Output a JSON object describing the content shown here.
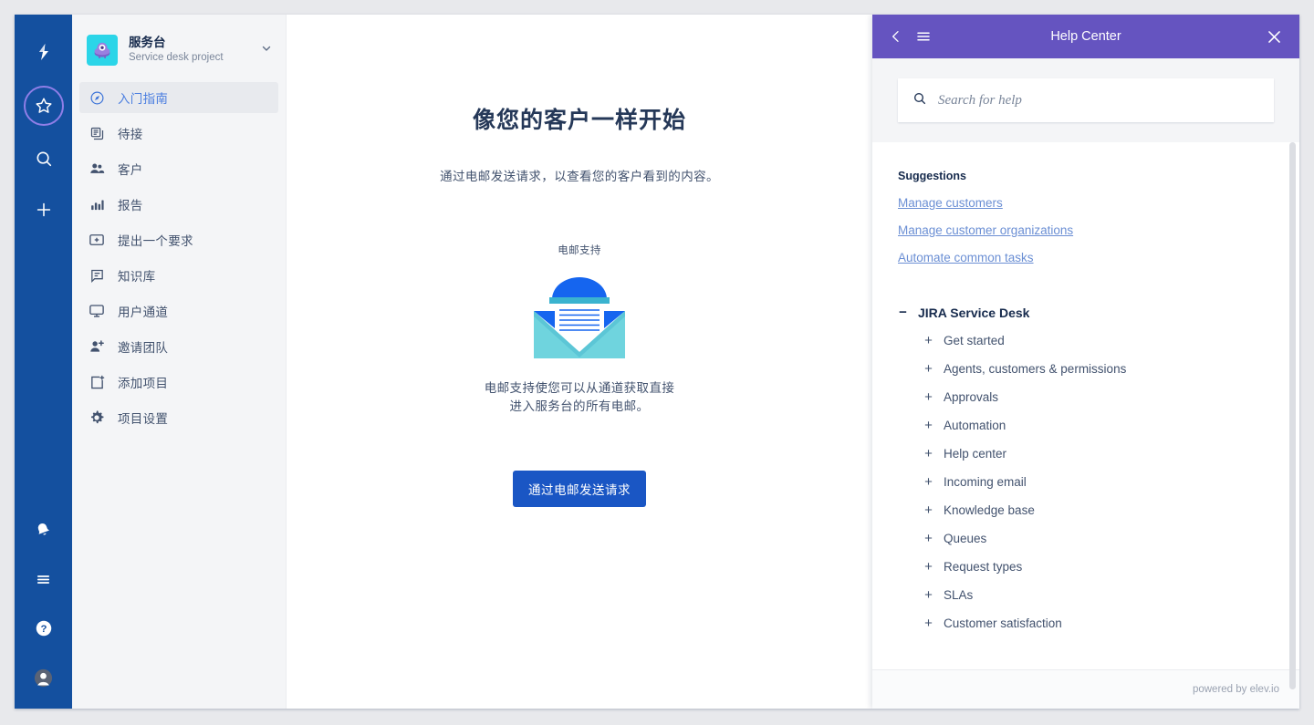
{
  "rail": {
    "top_items": [
      {
        "name": "jira-logo-icon",
        "label": "Jira"
      },
      {
        "name": "star-icon",
        "label": "Starred",
        "selected": true
      },
      {
        "name": "search-icon",
        "label": "Search"
      },
      {
        "name": "plus-icon",
        "label": "Create"
      }
    ],
    "bottom_items": [
      {
        "name": "notification-bell-icon",
        "label": "Notifications"
      },
      {
        "name": "list-lines-icon",
        "label": "Apps"
      },
      {
        "name": "help-question-icon",
        "label": "Help"
      },
      {
        "name": "user-avatar-icon",
        "label": "Your profile"
      }
    ]
  },
  "sidebar": {
    "project": {
      "name": "服务台",
      "subtitle": "Service desk project",
      "avatar_bg": "#2bd5e8",
      "chevron": "chevron-down-icon"
    },
    "items": [
      {
        "label": "入门指南",
        "icon": "compass-icon",
        "active": true
      },
      {
        "label": "待接",
        "icon": "queue-icon",
        "active": false
      },
      {
        "label": "客户",
        "icon": "people-icon",
        "active": false
      },
      {
        "label": "报告",
        "icon": "bar-chart-icon",
        "active": false
      },
      {
        "label": "提出一个要求",
        "icon": "add-request-icon",
        "active": false
      },
      {
        "label": "知识库",
        "icon": "book-icon",
        "active": false
      },
      {
        "label": "用户通道",
        "icon": "monitor-icon",
        "active": false
      },
      {
        "label": "邀请团队",
        "icon": "person-add-icon",
        "active": false
      },
      {
        "label": "添加项目",
        "icon": "add-item-icon",
        "active": false
      },
      {
        "label": "项目设置",
        "icon": "gear-icon",
        "active": false
      }
    ]
  },
  "main": {
    "title": "像您的客户一样开始",
    "subtitle": "通过电邮发送请求，以查看您的客户看到的内容。",
    "card": {
      "eyebrow": "电邮支持",
      "illustration": "open-envelope-icon",
      "description_line1": "电邮支持使您可以从通道获取直接",
      "description_line2": "进入服务台的所有电邮。"
    },
    "cta_label": "通过电邮发送请求",
    "cta_color": "#1a56c4"
  },
  "help_center": {
    "header": {
      "title": "Help Center",
      "back_icon": "chevron-left-icon",
      "menu_icon": "hamburger-menu-icon",
      "close_icon": "close-icon",
      "bg_color": "#6554c0"
    },
    "search": {
      "placeholder": "Search for help",
      "value": "",
      "icon": "search-icon"
    },
    "suggestions_title": "Suggestions",
    "suggestions": [
      "Manage customers",
      "Manage customer organizations",
      "Automate common tasks"
    ],
    "tree": {
      "root_label": "JIRA Service Desk",
      "root_symbol": "−",
      "child_symbol": "+",
      "children": [
        "Get started",
        "Agents, customers & permissions",
        "Approvals",
        "Automation",
        "Help center",
        "Incoming email",
        "Knowledge base",
        "Queues",
        "Request types",
        "SLAs",
        "Customer satisfaction"
      ]
    },
    "footer_text": "powered by elev.io"
  }
}
